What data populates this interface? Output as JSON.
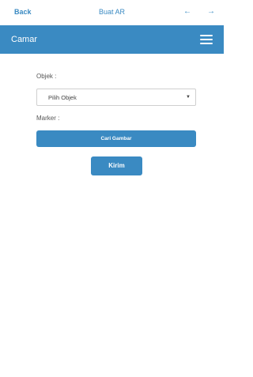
{
  "topbar": {
    "back_label": "Back",
    "title": "Buat AR",
    "arrow_left": "←",
    "arrow_right": "→"
  },
  "appbar": {
    "brand": "Camar",
    "menu_icon": "hamburger-menu-icon"
  },
  "form": {
    "objek_label": "Objek :",
    "objek_select": {
      "selected": "Pilih Objek",
      "caret": "▼"
    },
    "marker_label": "Marker :",
    "cari_gambar_label": "Cari Gambar",
    "kirim_label": "Kirim"
  },
  "colors": {
    "accent": "#3a8ac2",
    "background": "#ffffff"
  }
}
